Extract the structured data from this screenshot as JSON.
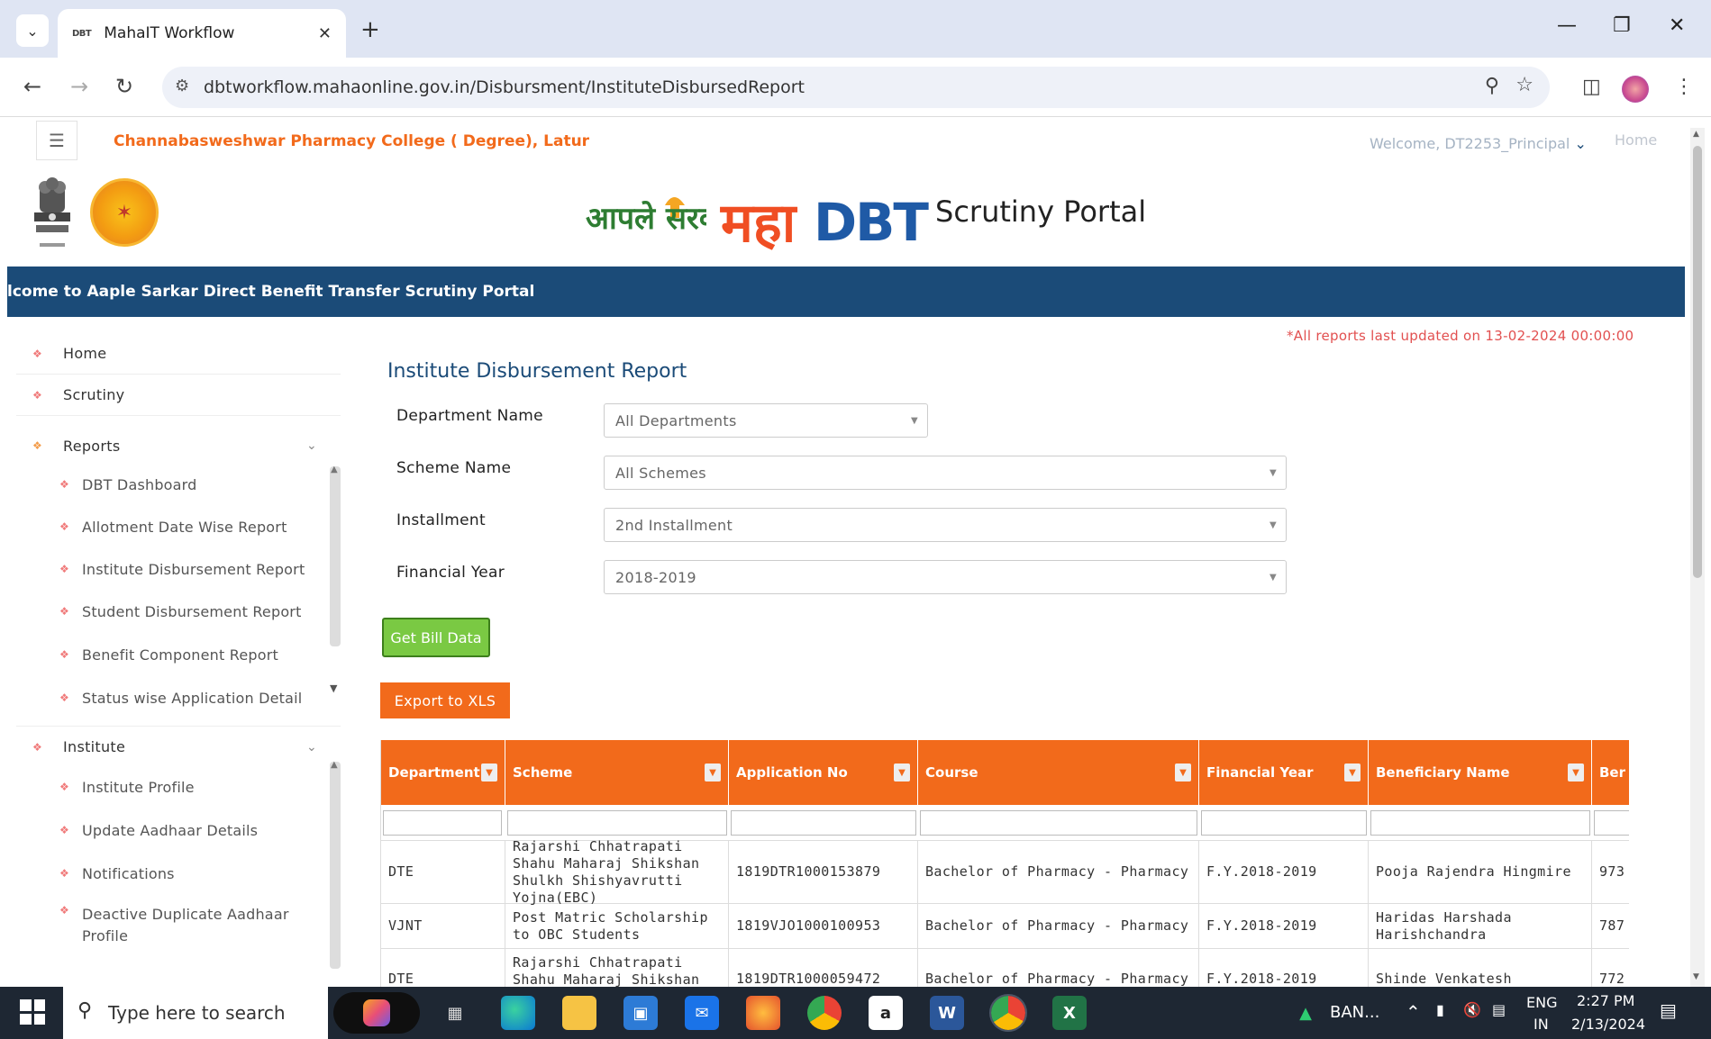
{
  "browser": {
    "tab_favicon_text": "DBT",
    "tab_title": "MahaIT Workflow",
    "url": "dbtworkflow.mahaonline.gov.in/Disbursment/InstituteDisbursedReport"
  },
  "header": {
    "college_name": "Channabasweshwar Pharmacy College ( Degree), Latur",
    "welcome": "Welcome, DT2253_Principal",
    "home_link": "Home",
    "logo_aaple": "आपले सरकार",
    "logo_maha": "महा",
    "logo_dbt": "DBT",
    "portal_title": "Scrutiny Portal",
    "banner": "lcome to Aaple Sarkar Direct Benefit Transfer Scrutiny Portal"
  },
  "sidebar": {
    "home": "Home",
    "scrutiny": "Scrutiny",
    "reports": "Reports",
    "report_items": [
      "DBT Dashboard",
      "Allotment Date Wise Report",
      "Institute Disbursement Report",
      "Student Disbursement Report",
      "Benefit Component Report",
      "Status wise Application Detail"
    ],
    "institute": "Institute",
    "institute_items": [
      "Institute Profile",
      "Update Aadhaar Details",
      "Notifications",
      "Deactive Duplicate Aadhaar",
      "Profile"
    ]
  },
  "main": {
    "updated_note": "*All reports last updated on 13-02-2024 00:00:00",
    "title": "Institute Disbursement Report",
    "fields": {
      "department_label": "Department Name",
      "department_value": "All Departments",
      "scheme_label": "Scheme Name",
      "scheme_value": "All Schemes",
      "installment_label": "Installment",
      "installment_value": "2nd Installment",
      "fy_label": "Financial Year",
      "fy_value": "2018-2019"
    },
    "get_bill_label": "Get Bill Data",
    "export_label": "Export to XLS"
  },
  "table": {
    "columns": [
      "Department",
      "Scheme",
      "Application No",
      "Course",
      "Financial Year",
      "Beneficiary Name",
      "Ber"
    ],
    "rows": [
      {
        "department": "DTE",
        "scheme": "Rajarshi Chhatrapati Shahu Maharaj Shikshan Shulkh Shishyavrutti Yojna(EBC)",
        "application_no": "1819DTR1000153879",
        "course": "Bachelor of Pharmacy - Pharmacy",
        "financial_year": "F.Y.2018-2019",
        "beneficiary": "Pooja Rajendra Hingmire",
        "extra": "973"
      },
      {
        "department": "VJNT",
        "scheme": "Post Matric Scholarship to OBC Students",
        "application_no": "1819VJO1000100953",
        "course": "Bachelor of Pharmacy - Pharmacy",
        "financial_year": "F.Y.2018-2019",
        "beneficiary": "Haridas Harshada Harishchandra",
        "extra": "787"
      },
      {
        "department": "DTE",
        "scheme": "Rajarshi Chhatrapati Shahu Maharaj Shikshan Shulkh",
        "application_no": "1819DTR1000059472",
        "course": "Bachelor of Pharmacy - Pharmacy",
        "financial_year": "F.Y.2018-2019",
        "beneficiary": "Shinde Venkatesh Shrikrishna",
        "extra": "772"
      }
    ]
  },
  "taskbar": {
    "search_placeholder": "Type here to search",
    "ban_label": "BAN...",
    "lang": "ENG",
    "region": "IN",
    "time": "2:27 PM",
    "date": "2/13/2024"
  },
  "colors": {
    "accent_orange": "#f26a1b",
    "banner_blue": "#1b4b78",
    "green_button": "#7ac943"
  }
}
